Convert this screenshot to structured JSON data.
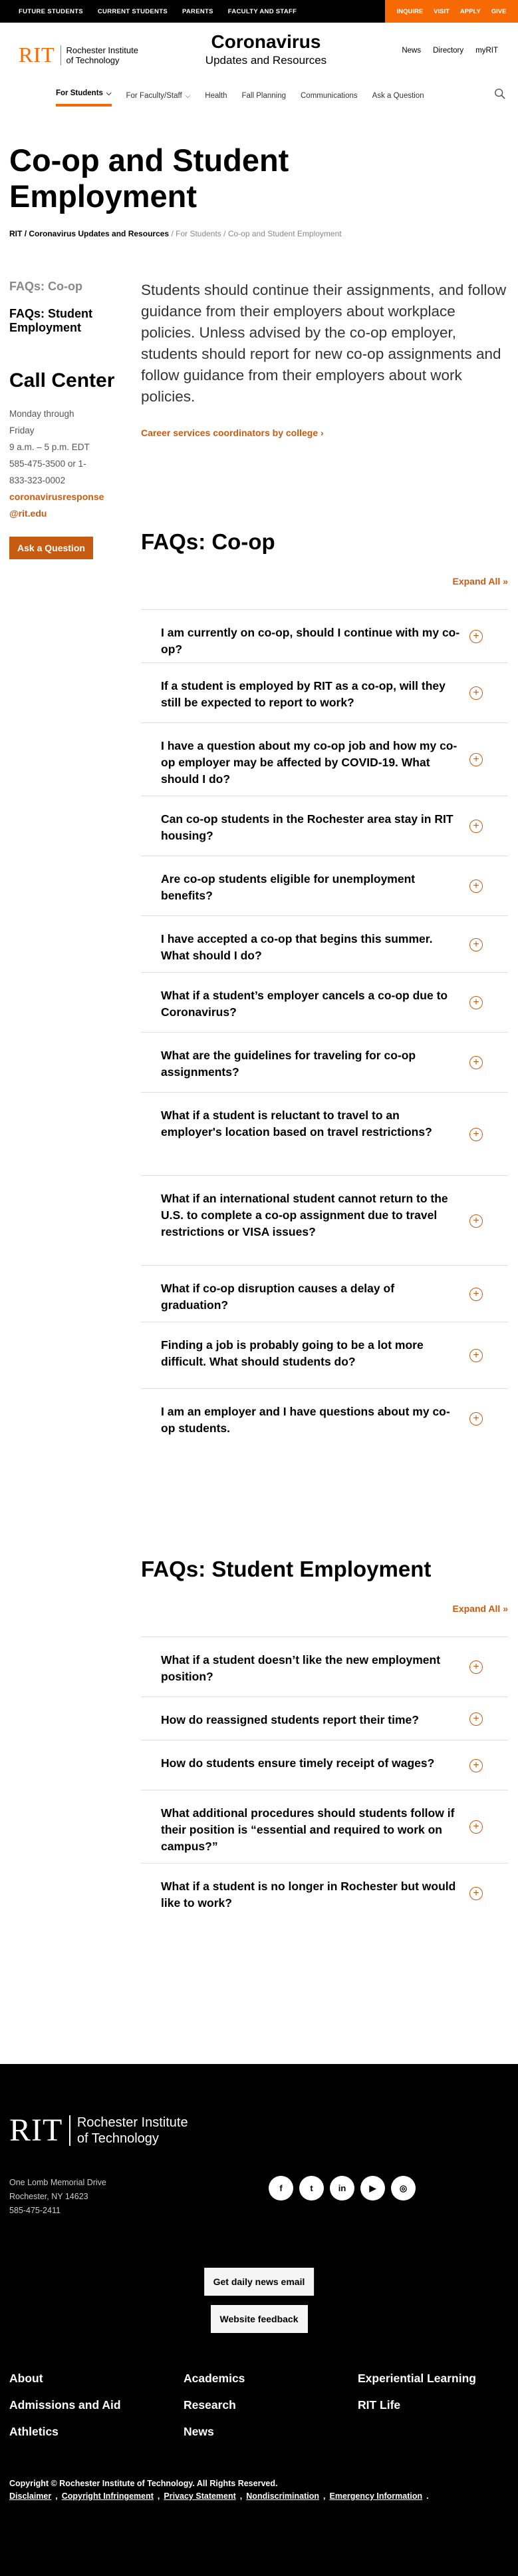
{
  "utility_bar": {
    "left_links": [
      "FUTURE STUDENTS",
      "CURRENT STUDENTS",
      "PARENTS",
      "FACULTY AND STAFF"
    ],
    "right_links": [
      "INQUIRE",
      "VISIT",
      "APPLY",
      "GIVE"
    ]
  },
  "header": {
    "logo_short": "RIT",
    "logo_full_line1": "Rochester Institute",
    "logo_full_line2": "of Technology",
    "site_title": "Coronavirus",
    "site_subtitle": "Updates and Resources",
    "util_links": [
      "News",
      "Directory",
      "myRIT"
    ],
    "nav": [
      "For Students",
      "For Faculty/Staff",
      "Health",
      "Fall Planning",
      "Communications",
      "Ask a Question"
    ]
  },
  "page": {
    "title": "Co-op and Student Employment",
    "breadcrumb": {
      "root": "RIT",
      "section": "Coronavirus Updates and Resources",
      "parent": "For Students",
      "current": "Co-op and Student Employment"
    }
  },
  "sidebar": {
    "links": [
      "FAQs: Co-op",
      "FAQs: Student Employment"
    ],
    "call_title": "Call Center",
    "hours_line1": "Monday through",
    "hours_line2": "Friday",
    "hours_line3": "9 a.m. – 5 p.m. EDT",
    "phone_line1": "585-475-3500 or 1-",
    "phone_line2": "833-323-0002",
    "email_line1": "coronavirusresponse",
    "email_line2": "@rit.edu",
    "ask_button": "Ask a Question"
  },
  "main": {
    "intro": "Students should continue their assignments, and follow guidance from their employers about workplace policies. Unless advised by the co-op employer, students should report for new co-op assignments and follow guidance from their employers about work policies.",
    "career_link": "Career services coordinators by college ›",
    "coop_section": {
      "title": "FAQs: Co-op",
      "expand": "Expand All",
      "questions": [
        "I am currently on co-op, should I continue with my co-op?",
        "If a student is employed by RIT as a co-op, will they still be expected to report to work?",
        "I have a question about my co-op job and how my co-op employer may be affected by COVID-19. What should I do?",
        "Can co-op students in the Rochester area stay in RIT housing?",
        "Are co-op students eligible for unemployment benefits?",
        "I have accepted a co-op that begins this summer. What should I do?",
        "What if a student’s employer cancels a co-op due to Coronavirus?",
        "What are the guidelines for traveling for co-op assignments?",
        "What if a student is reluctant to travel to an employer's location based on travel restrictions?",
        "What if an international student cannot return to the U.S. to complete a co-op assignment due to travel restrictions or VISA issues?",
        "What if co-op disruption causes a delay of graduation?",
        "Finding a job is probably going to be a lot more difficult. What should students do?",
        "I am an employer and I have questions about my co-op students."
      ]
    },
    "employment_section": {
      "title": "FAQs: Student Employment",
      "expand": "Expand All",
      "questions": [
        "What if a student doesn’t like the new employment position?",
        "How do reassigned students report their time?",
        "How do students ensure timely receipt of wages?",
        "What additional procedures should students follow if their position is “essential and required to work on campus?”",
        "What if a student is no longer in Rochester but would like to work?"
      ]
    }
  },
  "footer": {
    "logo_short": "RIT",
    "logo_full_line1": "Rochester Institute",
    "logo_full_line2": "of Technology",
    "address_line1": "One Lomb Memorial Drive",
    "address_line2": "Rochester, NY 14623",
    "phone": "585-475-2411",
    "socials": [
      "f",
      "t",
      "in",
      "▶",
      "◎"
    ],
    "news_email_button": "Get daily news email",
    "feedback_button": "Website feedback",
    "links": [
      "About",
      "Academics",
      "Experiential Learning",
      "Admissions and Aid",
      "Research",
      "RIT Life",
      "Athletics",
      "News"
    ],
    "copyright": "Copyright © Rochester Institute of Technology. All Rights Reserved.",
    "legal": [
      "Disclaimer",
      "Copyright Infringement",
      "Privacy Statement",
      "Nondiscrimination",
      "Emergency Information"
    ]
  }
}
